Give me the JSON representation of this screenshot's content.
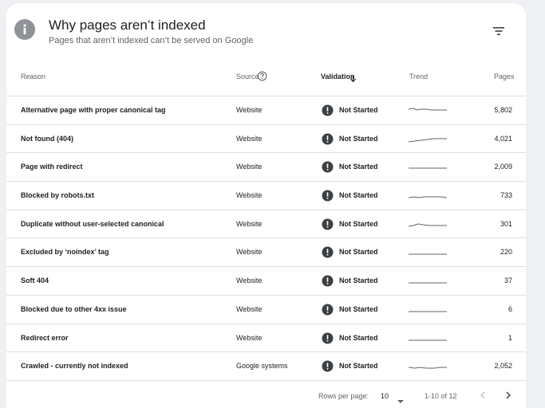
{
  "header": {
    "icon": "info-icon",
    "title": "Why pages aren’t indexed",
    "subtitle": "Pages that aren’t indexed can’t be served on Google",
    "filter_icon": "filter-icon"
  },
  "columns": {
    "reason": "Reason",
    "source": "Source",
    "validation": "Validation",
    "trend": "Trend",
    "pages": "Pages"
  },
  "rows": [
    {
      "reason": "Alternative page with proper canonical tag",
      "source": "Website",
      "status": "Not Started",
      "pages": "5,802"
    },
    {
      "reason": "Not found (404)",
      "source": "Website",
      "status": "Not Started",
      "pages": "4,021"
    },
    {
      "reason": "Page with redirect",
      "source": "Website",
      "status": "Not Started",
      "pages": "2,009"
    },
    {
      "reason": "Blocked by robots.txt",
      "source": "Website",
      "status": "Not Started",
      "pages": "733"
    },
    {
      "reason": "Duplicate without user-selected canonical",
      "source": "Website",
      "status": "Not Started",
      "pages": "301"
    },
    {
      "reason": "Excluded by ‘noindex’ tag",
      "source": "Website",
      "status": "Not Started",
      "pages": "220"
    },
    {
      "reason": "Soft 404",
      "source": "Website",
      "status": "Not Started",
      "pages": "37"
    },
    {
      "reason": "Blocked due to other 4xx issue",
      "source": "Website",
      "status": "Not Started",
      "pages": "6"
    },
    {
      "reason": "Redirect error",
      "source": "Website",
      "status": "Not Started",
      "pages": "1"
    },
    {
      "reason": "Crawled - currently not indexed",
      "source": "Google systems",
      "status": "Not Started",
      "pages": "2,052"
    }
  ],
  "footer": {
    "rows_per_page_label": "Rows per page:",
    "rows_per_page_value": "10",
    "range": "1-10 of 12"
  },
  "colors": {
    "status_icon": "#3c4043",
    "trend_line": "#5f6368",
    "divider": "#e0e0e0"
  }
}
